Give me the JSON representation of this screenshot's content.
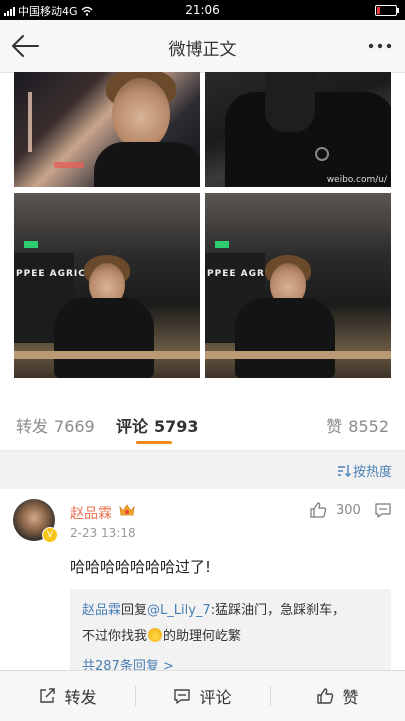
{
  "status_bar": {
    "carrier": "中国移动4G",
    "time": "21:06"
  },
  "nav": {
    "title": "微博正文"
  },
  "photos": {
    "watermark": "weibo.com/u/",
    "sign_text": "PPEE AGRICUL"
  },
  "stats": {
    "repost_label": "转发",
    "repost_count": "7669",
    "comment_label": "评论",
    "comment_count": "5793",
    "like_label": "赞",
    "like_count": "8552"
  },
  "sort": {
    "label": "按热度"
  },
  "comment": {
    "username": "赵品霖",
    "time": "2-23 13:18",
    "likes": "300",
    "text": "哈哈哈哈哈哈哈过了!",
    "reply": {
      "user": "赵品霖",
      "action": "回复",
      "mention": "@L_Lily_7",
      "text1": ":猛踩油门，急踩刹车，",
      "text2a": "不过你找我",
      "text2b": "的助理何屹繁",
      "more": "共287条回复 >"
    }
  },
  "bottom": {
    "repost": "转发",
    "comment": "评论",
    "like": "赞"
  },
  "colors": {
    "accent": "#f08a1c",
    "link": "#4a7fb5",
    "username": "#eb7350"
  }
}
